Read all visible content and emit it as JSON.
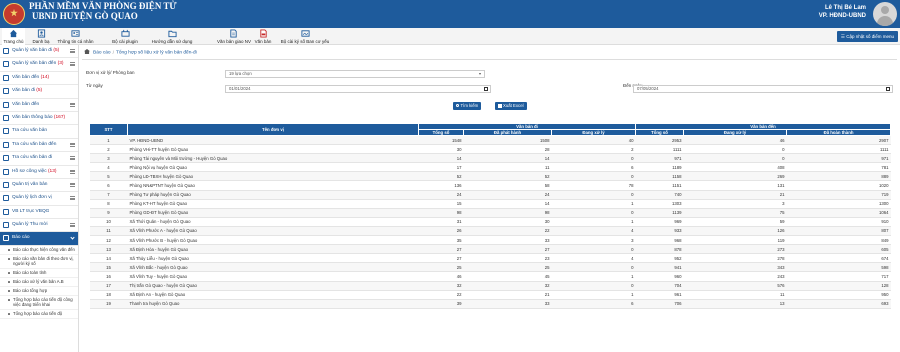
{
  "header": {
    "title_line1": "PHẦN MỀM VĂN PHÒNG ĐIỆN TỬ",
    "title_line2": "UBND HUYỆN GÒ QUAO",
    "user_name": "Lê Thị Bé Lam",
    "user_org": "VP. HĐND-UBND"
  },
  "toolbar": {
    "items": [
      {
        "label": "Trang chủ",
        "icon": "home-icon"
      },
      {
        "label": "Danh bạ",
        "icon": "contacts-icon"
      },
      {
        "label": "Thông tin cá nhân",
        "icon": "user-info-icon"
      },
      {
        "label": "Bộ cài plugin",
        "icon": "plugin-icon"
      },
      {
        "label": "Hướng dẫn sử dụng",
        "icon": "folder-icon"
      },
      {
        "label": "Văn bản giao NV",
        "icon": "document-icon"
      },
      {
        "label": "Văn bản",
        "icon": "pdf-icon"
      },
      {
        "label": "Bộ cài ký số Ban cơ yếu",
        "icon": "signature-icon"
      }
    ],
    "menu_button": "Cập nhật số điểm menu"
  },
  "sidebar": {
    "items": [
      {
        "label": "Quản lý văn bản đi",
        "count": "(5)"
      },
      {
        "label": "Quản lý văn bản đến",
        "count": "(3)"
      },
      {
        "label": "Văn bản đến",
        "count": "(14)"
      },
      {
        "label": "Văn bản đi",
        "count": "(5)"
      },
      {
        "label": "Văn bản đến",
        "count": ""
      },
      {
        "label": "Văn bản thông báo",
        "count": "(167)"
      },
      {
        "label": "Tra cứu văn bản",
        "count": ""
      },
      {
        "label": "Tra cứu văn bản đến",
        "count": ""
      },
      {
        "label": "Tra cứu văn bản đi",
        "count": ""
      },
      {
        "label": "Hồ sơ công việc",
        "count": "(13)"
      },
      {
        "label": "Quản trị văn bản",
        "count": ""
      },
      {
        "label": "Quản lý lịch đơn vị",
        "count": ""
      },
      {
        "label": "VB LT trục VBQG",
        "count": ""
      },
      {
        "label": "Quản lý Thu mời",
        "count": ""
      }
    ],
    "open_item": "Báo cáo",
    "sub_items": [
      "Báo cáo thực hiện công văn đến",
      "Báo cáo văn bản đi theo đơn vị, người ký số",
      "Báo cáo toàn tỉnh",
      "Báo cáo xử lý văn bản A.B",
      "Báo cáo tổng hợp",
      "Tổng hợp báo cáo tiến độ công việc đang triển khai",
      "Tổng hợp báo cáo tiến độ"
    ]
  },
  "breadcrumb": {
    "root": "Báo cáo",
    "current": "Tổng hợp số liệu xử lý văn bản đến-đi"
  },
  "filters": {
    "unit_label": "Đơn vị xử lý/ Phòng ban",
    "unit_value": "19 lựa chọn",
    "from_label": "Từ ngày",
    "from_value": "01/01/2024",
    "to_label": "Đến ngày",
    "to_value": "07/05/2024",
    "search_button": "Tìm kiếm",
    "export_button": "Xuất Excel"
  },
  "table": {
    "headers": {
      "stt": "STT",
      "unit": "Tên đơn vị",
      "outgoing": "Văn bản đi",
      "incoming": "Văn bản đến",
      "total": "Tổng số",
      "done": "Đã phát hành",
      "processing": "Đang xử lý",
      "total2": "Tổng số",
      "processing2": "Đang xử lý",
      "completed": "Đã hoàn thành"
    },
    "rows": [
      [
        "1",
        "VP. HĐND-UBND",
        "1548",
        "1508",
        "40",
        "2953",
        "46",
        "2907"
      ],
      [
        "2",
        "Phòng VHi-TT huyện Gò Quao",
        "30",
        "28",
        "2",
        "1111",
        "0",
        "1111"
      ],
      [
        "3",
        "Phòng Tài nguyên và Môi trường - Huyện Gò Quao",
        "14",
        "14",
        "0",
        "971",
        "0",
        "971"
      ],
      [
        "4",
        "Phòng Nội vụ huyện Gò Quao",
        "17",
        "11",
        "6",
        "1189",
        "408",
        "781"
      ],
      [
        "5",
        "Phòng LĐ-TBXH huyện Gò Quao",
        "52",
        "52",
        "0",
        "1158",
        "269",
        "889"
      ],
      [
        "6",
        "Phòng NN&PTNT huyện Gò Quao",
        "136",
        "58",
        "78",
        "1151",
        "131",
        "1020"
      ],
      [
        "7",
        "Phòng Tư pháp huyện Gò Quao",
        "24",
        "24",
        "0",
        "740",
        "21",
        "719"
      ],
      [
        "8",
        "Phòng KT-HT huyện Gò Quao",
        "15",
        "14",
        "1",
        "1303",
        "3",
        "1300"
      ],
      [
        "9",
        "Phòng GD-ĐT huyện Gò Quao",
        "98",
        "98",
        "0",
        "1139",
        "75",
        "1064"
      ],
      [
        "10",
        "Xã Thới Quản - huyện Gò Quao",
        "31",
        "30",
        "1",
        "969",
        "59",
        "910"
      ],
      [
        "11",
        "Xã Vĩnh Phước A - huyện Gò Quao",
        "26",
        "22",
        "4",
        "933",
        "126",
        "807"
      ],
      [
        "12",
        "Xã Vĩnh Phước B - huyện Gò Quao",
        "35",
        "33",
        "3",
        "968",
        "119",
        "849"
      ],
      [
        "13",
        "Xã Định Hòa - huyện Gò Quao",
        "27",
        "27",
        "0",
        "878",
        "273",
        "605"
      ],
      [
        "14",
        "Xã Thủy Liễu - huyện Gò Quao",
        "27",
        "23",
        "4",
        "952",
        "278",
        "674"
      ],
      [
        "15",
        "Xã Vĩnh Bắc - huyện Gò Quao",
        "25",
        "25",
        "0",
        "941",
        "343",
        "598"
      ],
      [
        "16",
        "Xã Vĩnh Tuy - huyện Gò Quao",
        "46",
        "45",
        "1",
        "960",
        "243",
        "717"
      ],
      [
        "17",
        "Thị trấn Gò Quao - huyện Gò Quao",
        "32",
        "32",
        "0",
        "704",
        "576",
        "128"
      ],
      [
        "18",
        "Xã Định An - huyện Gò Quao",
        "22",
        "21",
        "1",
        "961",
        "11",
        "950"
      ],
      [
        "19",
        "Thanh tra huyện Gò Quao",
        "39",
        "33",
        "6",
        "706",
        "13",
        "693"
      ]
    ]
  }
}
